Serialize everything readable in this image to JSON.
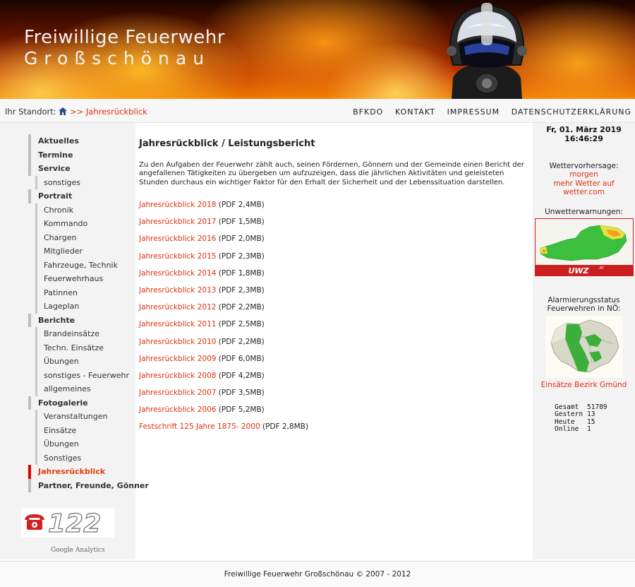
{
  "header": {
    "title_line1": "Freiwillige Feuerwehr",
    "title_line2": "Großschönau"
  },
  "location": {
    "label": "Ihr Standort:",
    "separator": ">>",
    "current": "Jahresrückblick"
  },
  "topnav": [
    "BFKDO",
    "KONTAKT",
    "IMPRESSUM",
    "DATENSCHUTZERKLÄRUNG"
  ],
  "sidebar": {
    "items": [
      {
        "label": "Aktuelles",
        "level": "top"
      },
      {
        "label": "Termine",
        "level": "top"
      },
      {
        "label": "Service",
        "level": "top"
      },
      {
        "label": "sonstiges",
        "level": "sub"
      },
      {
        "label": "Portrait",
        "level": "top"
      },
      {
        "label": "Chronik",
        "level": "sub"
      },
      {
        "label": "Kommando",
        "level": "sub"
      },
      {
        "label": "Chargen",
        "level": "sub"
      },
      {
        "label": "Mitglieder",
        "level": "sub"
      },
      {
        "label": "Fahrzeuge, Technik",
        "level": "sub"
      },
      {
        "label": "Feuerwehrhaus",
        "level": "sub"
      },
      {
        "label": "Patinnen",
        "level": "sub"
      },
      {
        "label": "Lageplan",
        "level": "sub"
      },
      {
        "label": "Berichte",
        "level": "top"
      },
      {
        "label": "Brandeinsätze",
        "level": "sub"
      },
      {
        "label": "Techn. Einsätze",
        "level": "sub"
      },
      {
        "label": "Übungen",
        "level": "sub"
      },
      {
        "label": "sonstiges - Feuerwehr",
        "level": "sub"
      },
      {
        "label": "allgemeines",
        "level": "sub"
      },
      {
        "label": "Fotogalerie",
        "level": "top"
      },
      {
        "label": "Veranstaltungen",
        "level": "sub"
      },
      {
        "label": "Einsätze",
        "level": "sub"
      },
      {
        "label": "Übungen",
        "level": "sub"
      },
      {
        "label": "Sonstiges",
        "level": "sub"
      },
      {
        "label": "Jahresrückblick",
        "level": "top",
        "active": true
      },
      {
        "label": "Partner, Freunde, Gönner",
        "level": "top"
      }
    ],
    "phone_number": "122",
    "analytics": "Google Analytics"
  },
  "main": {
    "heading": "Jahresrückblick / Leistungsbericht",
    "intro": "Zu den Aufgaben der Feuerwehr zählt auch, seinen Fördernen, Gönnern und der Gemeinde einen Bericht der angefallenen Tätigkeiten zu übergeben um aufzuzeigen, dass die jährlichen Aktivitäten und geleisteten Stunden durchaus ein wichtiger Faktor für den Erhalt der Sicherheit und der Lebenssituation darstellen.",
    "reports": [
      {
        "label": "Jahresrückblick 2018",
        "size": "(PDF 2,4MB)"
      },
      {
        "label": "Jahresrückblick 2017",
        "size": "(PDF 1,5MB)"
      },
      {
        "label": "Jahresrückblick 2016",
        "size": "(PDF 2,0MB)"
      },
      {
        "label": "Jahresrückblick 2015",
        "size": "(PDF 2,3MB)"
      },
      {
        "label": "Jahresrückblick 2014",
        "size": "(PDF 1,8MB)"
      },
      {
        "label": "Jahresrückblick 2013",
        "size": "(PDF 2,3MB)"
      },
      {
        "label": "Jahresrückblick 2012",
        "size": "(PDF 2,2MB)"
      },
      {
        "label": "Jahresrückblick 2011",
        "size": "(PDF 2,5MB)"
      },
      {
        "label": "Jahresrückblick 2010",
        "size": "(PDF 2,2MB)"
      },
      {
        "label": "Jahresrückblick 2009",
        "size": "(PDF 6,0MB)"
      },
      {
        "label": "Jahresrückblick 2008",
        "size": "(PDF 4,2MB)"
      },
      {
        "label": "Jahresrückblick 2007",
        "size": "(PDF 3,5MB)"
      },
      {
        "label": "Jahresrückblick 2006",
        "size": "(PDF 5,2MB)"
      },
      {
        "label": "Festschrift 125 Jahre 1875- 2000",
        "size": "(PDF 2,8MB)"
      }
    ]
  },
  "right": {
    "date": "Fr, 01. März 2019",
    "time": "16:46:29",
    "weather_title": "Wettervorhersage:",
    "weather_links": [
      "morgen",
      "mehr Wetter auf",
      "wetter.com"
    ],
    "warnings_title": "Unwetterwarnungen:",
    "uwz_logo": "UWZ",
    "uwz_suffix": ".AT",
    "alarm_title_line1": "Alarmierungsstatus",
    "alarm_title_line2": "Feuerwehren in NÖ:",
    "einsaetze_link": "Einsätze Bezirk Gmünd",
    "counter": [
      {
        "label": "Gesamt",
        "value": "51789"
      },
      {
        "label": "Gestern",
        "value": "13"
      },
      {
        "label": "Heute",
        "value": "15"
      },
      {
        "label": "Online",
        "value": "1"
      }
    ]
  },
  "footer": {
    "text": "Freiwillige Feuerwehr Großschönau © 2007 - 2012"
  },
  "colors": {
    "accent": "#e03010",
    "active_marker": "#e00000",
    "map_green": "#3cbf3c",
    "map_yellow": "#e8e040",
    "map_orange": "#f0a020"
  }
}
